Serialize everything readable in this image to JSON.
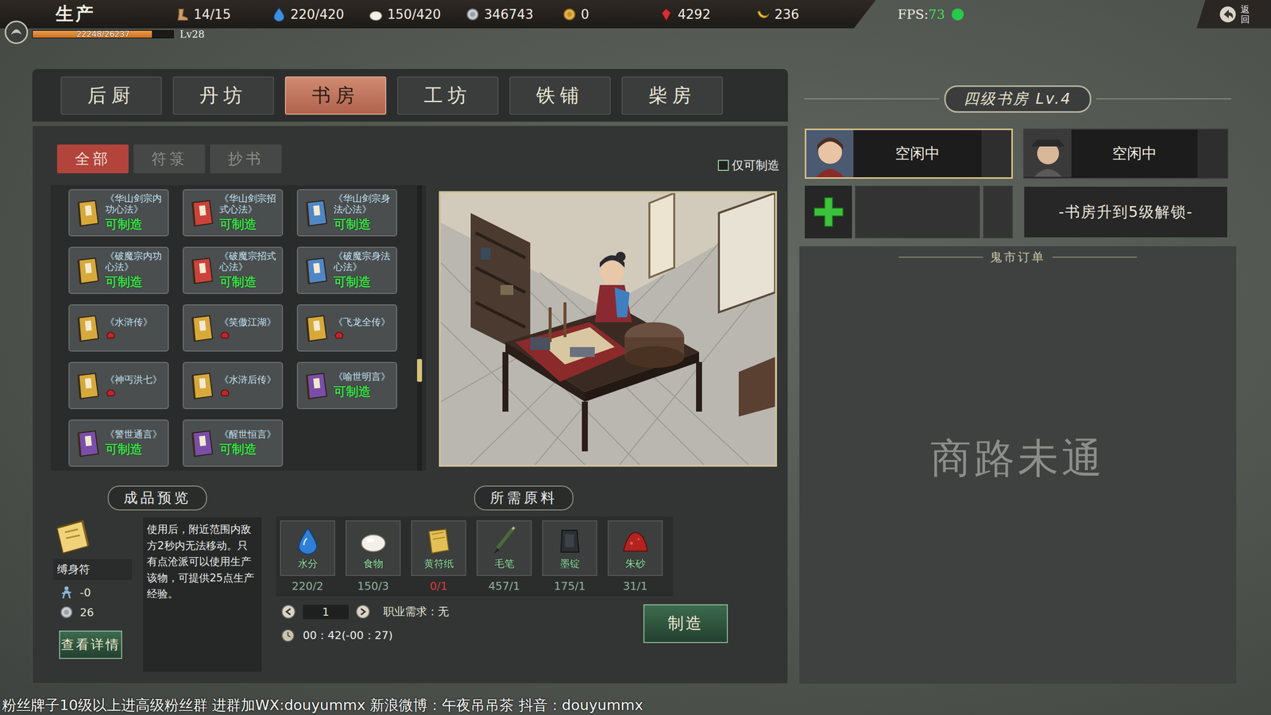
{
  "top_bar": {
    "title": "生产",
    "exp": {
      "reading": "22248/26237",
      "level": 0.848
    },
    "player_level": "Lv28",
    "resources": [
      {
        "kind": "stamina",
        "value": "14/15"
      },
      {
        "kind": "water",
        "value": "220/420"
      },
      {
        "kind": "food",
        "value": "150/420"
      },
      {
        "kind": "silver",
        "value": "346743"
      },
      {
        "kind": "gold",
        "value": "0"
      },
      {
        "kind": "gem",
        "value": "4292"
      },
      {
        "kind": "banana",
        "value": "236"
      }
    ],
    "fps": {
      "label": "FPS:",
      "value": "73",
      "ok": true
    },
    "back_button": "返回"
  },
  "tabs": [
    {
      "label": "后厨",
      "selected": false
    },
    {
      "label": "丹坊",
      "selected": false
    },
    {
      "label": "书房",
      "selected": true
    },
    {
      "label": "工坊",
      "selected": false
    },
    {
      "label": "铁铺",
      "selected": false
    },
    {
      "label": "柴房",
      "selected": false
    }
  ],
  "sub_tabs": [
    {
      "label": "全部",
      "selected": true
    },
    {
      "label": "符箓",
      "selected": false
    },
    {
      "label": "抄书",
      "selected": false
    }
  ],
  "filter": {
    "label": "仅可制造",
    "checked": false
  },
  "recipes": [
    {
      "title": "《华山剑宗内功心法》",
      "status": "可制造",
      "craftable": true,
      "color": "#d6a93a"
    },
    {
      "title": "《华山剑宗招式心法》",
      "status": "可制造",
      "craftable": true,
      "color": "#c9433b"
    },
    {
      "title": "《华山剑宗身法心法》",
      "status": "可制造",
      "craftable": true,
      "color": "#4f86c6"
    },
    {
      "title": "《破魔宗内功心法》",
      "status": "可制造",
      "craftable": true,
      "color": "#d6a93a"
    },
    {
      "title": "《破魔宗招式心法》",
      "status": "可制造",
      "craftable": true,
      "color": "#c9433b"
    },
    {
      "title": "《破魔宗身法心法》",
      "status": "可制造",
      "craftable": true,
      "color": "#4f86c6"
    },
    {
      "title": "《水浒传》",
      "status": "",
      "craftable": false,
      "color": "#d6a93a"
    },
    {
      "title": "《笑傲江湖》",
      "status": "",
      "craftable": false,
      "color": "#d6a93a"
    },
    {
      "title": "《飞龙全传》",
      "status": "",
      "craftable": false,
      "color": "#d6a93a"
    },
    {
      "title": "《神丐洪七》",
      "status": "",
      "craftable": false,
      "color": "#d6a93a"
    },
    {
      "title": "《水浒后传》",
      "status": "",
      "craftable": false,
      "color": "#d6a93a"
    },
    {
      "title": "《喻世明言》",
      "status": "可制造",
      "craftable": true,
      "color": "#7a4ea8"
    },
    {
      "title": "《警世通言》",
      "status": "可制造",
      "craftable": true,
      "color": "#7a4ea8"
    },
    {
      "title": "《醒世恒言》",
      "status": "可制造",
      "craftable": true,
      "color": "#7a4ea8"
    }
  ],
  "preview": {
    "label": "成品预览",
    "item_name": "缚身符",
    "stats": [
      {
        "kind": "skill",
        "value": "-0"
      },
      {
        "kind": "silver",
        "value": "26"
      }
    ],
    "description": "使用后，附近范围内敌方2秒内无法移动。只有点沧派可以使用生产该物，可提供25点生产经验。",
    "details_button": "查看详情"
  },
  "materials": {
    "label": "所需原料",
    "items": [
      {
        "kind": "water",
        "name": "水分",
        "count": "220/2",
        "sufficient": true
      },
      {
        "kind": "food",
        "name": "食物",
        "count": "150/3",
        "sufficient": true
      },
      {
        "kind": "paper",
        "name": "黄符纸",
        "count": "0/1",
        "sufficient": false
      },
      {
        "kind": "brush",
        "name": "毛笔",
        "count": "457/1",
        "sufficient": true
      },
      {
        "kind": "ink",
        "name": "墨锭",
        "count": "175/1",
        "sufficient": true
      },
      {
        "kind": "cinnabar",
        "name": "朱砂",
        "count": "31/1",
        "sufficient": true
      }
    ]
  },
  "craft": {
    "quantity": "1",
    "job_requirement": "职业需求：无",
    "time": "00：42(-00：27)",
    "button": "制造"
  },
  "workshop": {
    "title": "四级书房 Lv.4",
    "slots": [
      {
        "kind": "worker",
        "status": "空闲中",
        "selected": true
      },
      {
        "kind": "worker",
        "status": "空闲中",
        "selected": false
      },
      {
        "kind": "add",
        "status": "",
        "selected": false
      },
      {
        "kind": "locked",
        "status": "-书房升到5级解锁-",
        "selected": false
      }
    ]
  },
  "market": {
    "title": "鬼市订单",
    "message": "商路未通"
  },
  "overlay_text": "粉丝牌子10级以上进高级粉丝群 进群加WX:douyummx 新浪微博：午夜吊吊茶 抖音：douyummx"
}
